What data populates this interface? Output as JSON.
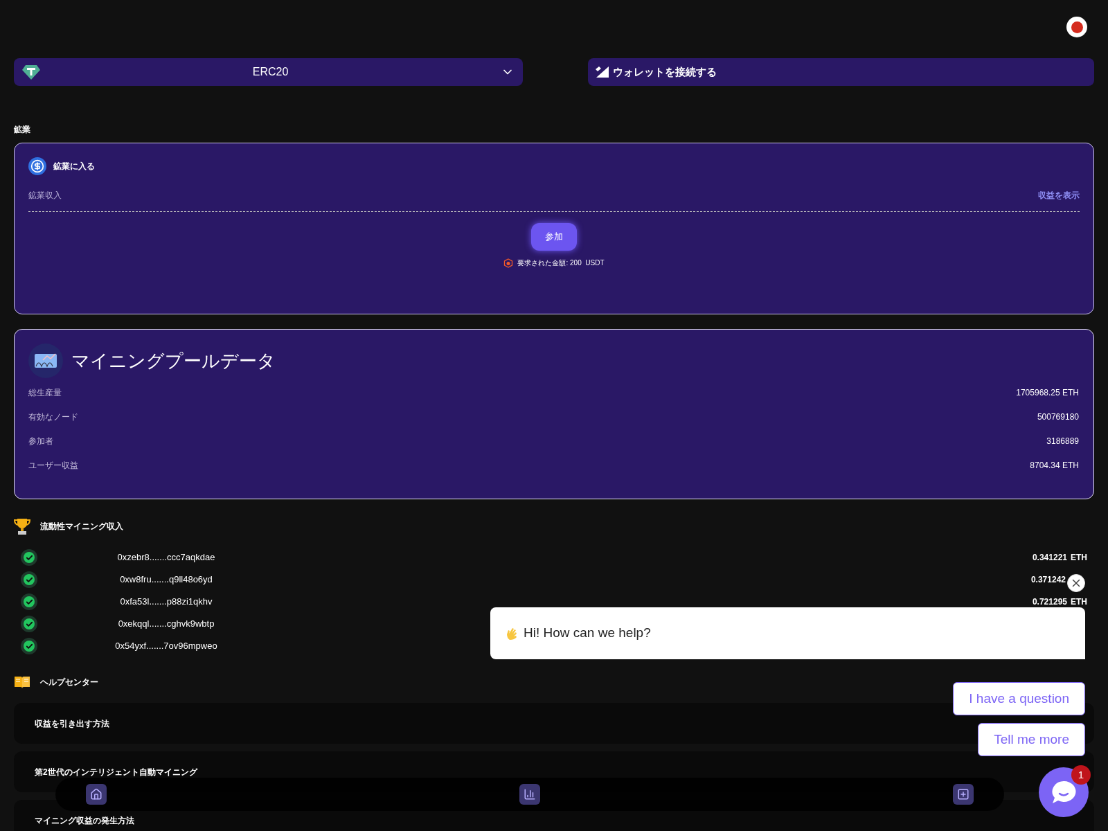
{
  "network_select": {
    "value": "ERC20"
  },
  "wallet_button": {
    "label": "ウォレットを接続する"
  },
  "mining": {
    "section_title": "鉱業",
    "card_title": "鉱業に入る",
    "income_label": "鉱業収入",
    "view_link": "収益を表示",
    "join_button": "参加",
    "required_amount": "要求された金額: 200  USDT"
  },
  "pool_data": {
    "title": "マイニングプールデータ",
    "stats": [
      {
        "label": "総生産量",
        "value": "1705968.25 ETH"
      },
      {
        "label": "有効なノード",
        "value": "500769180"
      },
      {
        "label": "参加者",
        "value": "3186889"
      },
      {
        "label": "ユーザー収益",
        "value": "8704.34 ETH"
      }
    ]
  },
  "liquidity": {
    "title": "流動性マイニング収入",
    "rows": [
      {
        "address": "0xzebr8.......ccc7aqkdae",
        "verified": true,
        "amount": "0.341221",
        "unit": "ETH"
      },
      {
        "address": "0xw8fru.......q9ll48o6yd",
        "verified": true,
        "amount": "0.371242"
      },
      {
        "address": "0xfa53l.......p88zi1qkhv",
        "verified": true,
        "amount": "0.721295",
        "unit": "ETH"
      },
      {
        "address": "0xekqql.......cghvk9wbtp",
        "verified": true
      },
      {
        "address": "0x54yxf.......7ov96mpweo",
        "verified": true
      }
    ]
  },
  "help_center": {
    "title": "ヘルプセンター",
    "items": [
      "収益を引き出す方法",
      "第2世代のインテリジェント自動マイニング",
      "マイニング収益の発生方法"
    ]
  },
  "chat": {
    "greeting": "Hi! How can we help?",
    "replies": [
      "I have a question",
      "Tell me more"
    ],
    "unread_badge": "1"
  }
}
